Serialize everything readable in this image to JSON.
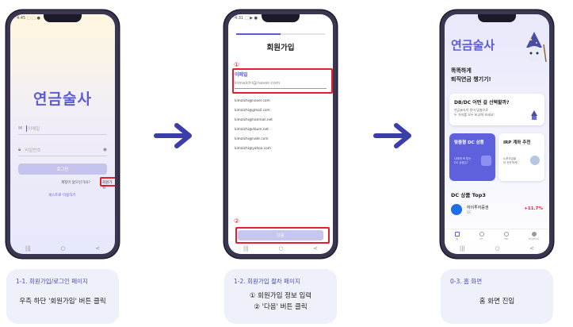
{
  "phone1": {
    "status_time": "4:45 ⬚ ⬚ ●",
    "logo": "연금술사",
    "email_placeholder": "이메일",
    "password_placeholder": "비밀번호",
    "login_button": "로그인",
    "account_question": "계정이 없으신가요?",
    "signup_link": "회원가입",
    "guest_link": "게스트로 이용하기",
    "nav": [
      "|||",
      "○",
      "<"
    ]
  },
  "phone2": {
    "status_time": "4:31 ⬚ ▶ ●",
    "title": "회원가입",
    "progress": 0.5,
    "marker1": "①",
    "email_label": "이메일",
    "email_value": "kimalchi@naver.com",
    "suggestions": [
      "kimalchi@naver.com",
      "kimalchi@gmail.com",
      "kimalchi@hanmail.net",
      "kimalchi@daum.net",
      "kimalchi@nate.com",
      "kimalchi@yahoo.com"
    ],
    "marker2": "②",
    "next_button": "다음",
    "nav": [
      "|||",
      "○",
      "<"
    ]
  },
  "phone3": {
    "logo": "연금술사",
    "tagline1": "똑똑하게",
    "tagline2": "퇴직연금 챙기기!",
    "card1_title": "DB/DC 어떤 걸 선택할까?",
    "card1_sub1": "연금술사의 용어 맞춤으로",
    "card1_sub2": "두 가지를 모두 비교해 보세요!",
    "card2_title": "맞춤형 DC 상품",
    "card2_sub1": "나에게 꼭 맞는",
    "card2_sub2": "DC 상품은?",
    "card3_title": "IRP 계좌 추천",
    "card3_sub1": "노후자금을",
    "card3_sub2": "더 든든하게!",
    "section_title": "DC 상품 Top3",
    "product_name": "하이투자증권",
    "product_type": "DC",
    "product_rate": "+11.7%",
    "tabs": [
      "홈",
      "DC",
      "IRP",
      "마이페이지"
    ],
    "nav": [
      "|||",
      "○",
      "<"
    ]
  },
  "captions": [
    {
      "label": "1-1. 회원가입/로그인 페이지",
      "lines": [
        "우측 하단 '회원가입' 버튼 클릭"
      ]
    },
    {
      "label": "1-2. 회원가입 절차 페이지",
      "lines": [
        "① 회원가입 정보 입력",
        "② '다음' 버튼 클릭"
      ]
    },
    {
      "label": "0-3. 홈 화면",
      "lines": [
        "홈 화면 진입"
      ]
    }
  ],
  "colors": {
    "accent": "#5b5cd6",
    "highlight": "#e5202e",
    "arrow": "#3c3ea8",
    "caption_bg": "#eef1f9",
    "card_primary": "#5f60dc",
    "rate_up": "#e5202e"
  }
}
